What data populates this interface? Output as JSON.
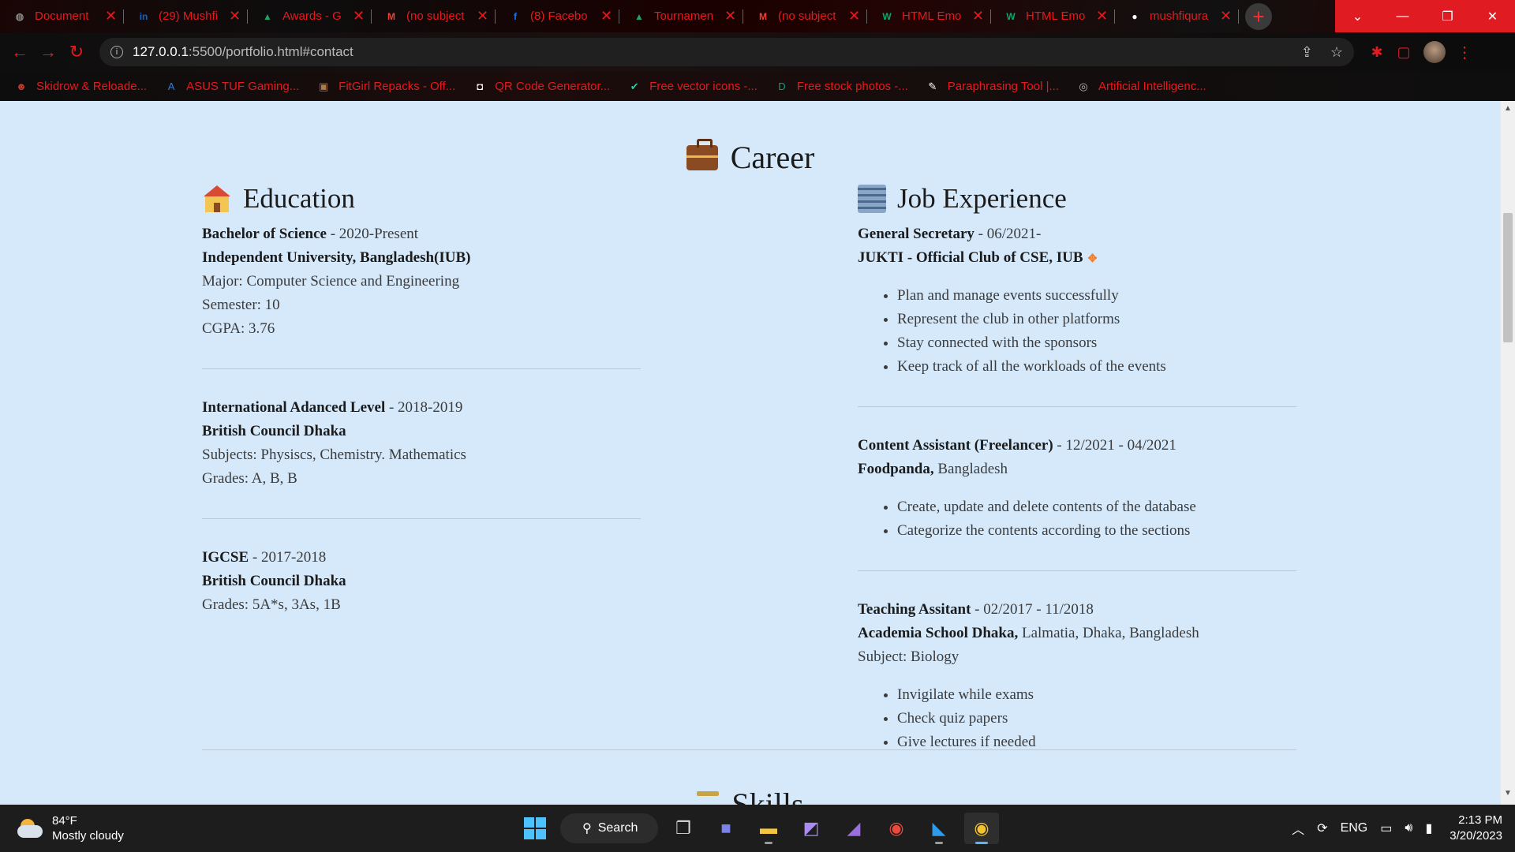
{
  "browser": {
    "tabs": [
      {
        "title": "Document",
        "icon": "globe-icon",
        "icon_char": "◍",
        "icon_color": "#888888"
      },
      {
        "title": "(29) Mushfi",
        "icon": "linkedin-icon",
        "icon_char": "in",
        "icon_color": "#0a66c2"
      },
      {
        "title": "Awards - G",
        "icon": "google-drive-icon",
        "icon_char": "▲",
        "icon_color": "#1fa463"
      },
      {
        "title": "(no subject",
        "icon": "gmail-icon",
        "icon_char": "M",
        "icon_color": "#ea4335"
      },
      {
        "title": "(8) Facebo",
        "icon": "facebook-icon",
        "icon_char": "f",
        "icon_color": "#1877f2"
      },
      {
        "title": "Tournamen",
        "icon": "google-drive-icon",
        "icon_char": "▲",
        "icon_color": "#1fa463"
      },
      {
        "title": "(no subject",
        "icon": "gmail-icon",
        "icon_char": "M",
        "icon_color": "#ea4335"
      },
      {
        "title": "HTML Emo",
        "icon": "w3schools-icon",
        "icon_char": "W",
        "icon_color": "#04aa6d"
      },
      {
        "title": "HTML Emo",
        "icon": "w3schools-icon",
        "icon_char": "W",
        "icon_color": "#04aa6d"
      },
      {
        "title": "mushfiqura",
        "icon": "github-icon",
        "icon_char": "●",
        "icon_color": "#ffffff"
      }
    ],
    "close_glyph": "✕",
    "new_tab_glyph": "+",
    "window_controls": {
      "dropdown": "⌄",
      "minimize": "—",
      "restore": "❐",
      "close": "✕"
    },
    "address": {
      "host": "127.0.0.1",
      "rest": ":5500/portfolio.html#contact"
    },
    "bookmarks": [
      {
        "label": "Skidrow & Reloade...",
        "icon": "skidrow-icon",
        "icon_char": "☻",
        "icon_color": "#c0392b"
      },
      {
        "label": "ASUS TUF Gaming...",
        "icon": "asus-tuf-icon",
        "icon_char": "A",
        "icon_color": "#2f7de1"
      },
      {
        "label": "FitGirl Repacks - Off...",
        "icon": "fitgirl-icon",
        "icon_char": "▣",
        "icon_color": "#b07a4a"
      },
      {
        "label": "QR Code Generator...",
        "icon": "qr-code-icon",
        "icon_char": "◘",
        "icon_color": "#ffffff"
      },
      {
        "label": "Free vector icons -...",
        "icon": "vector-icons-icon",
        "icon_char": "✔",
        "icon_color": "#1dd1a1"
      },
      {
        "label": "Free stock photos -...",
        "icon": "stock-photos-icon",
        "icon_char": "D",
        "icon_color": "#05a081"
      },
      {
        "label": "Paraphrasing Tool |...",
        "icon": "pen-icon",
        "icon_char": "✎",
        "icon_color": "#ffffff"
      },
      {
        "label": "Artificial Intelligenc...",
        "icon": "openai-icon",
        "icon_char": "◎",
        "icon_color": "#bbbbbb"
      }
    ],
    "accent_color": "#e8191d"
  },
  "page": {
    "career_title": "Career",
    "education": {
      "heading": "Education",
      "entries": [
        {
          "degree": "Bachelor of Science",
          "period": " - 2020-Present",
          "institution": "Independent University, Bangladesh(IUB)",
          "details": [
            "Major: Computer Science and Engineering",
            "Semester: 10",
            "CGPA: 3.76"
          ]
        },
        {
          "degree": "International Adanced Level",
          "period": " - 2018-2019",
          "institution": "British Council Dhaka",
          "details": [
            "Subjects: Physiscs, Chemistry. Mathematics",
            "Grades: A, B, B"
          ]
        },
        {
          "degree": "IGCSE",
          "period": " - 2017-2018",
          "institution": "British Council Dhaka",
          "details": [
            "Grades: 5A*s, 3As, 1B"
          ]
        }
      ]
    },
    "jobs": {
      "heading": "Job Experience",
      "entries": [
        {
          "role": "General Secretary",
          "period": " - 06/2021-",
          "org": "JUKTI - Official Club of CSE, IUB",
          "org_suffix": "",
          "subject": "",
          "bullets": [
            "Plan and manage events successfully",
            "Represent the club in other platforms",
            "Stay connected with the sponsors",
            "Keep track of all the workloads of the events"
          ]
        },
        {
          "role": "Content Assistant (Freelancer)",
          "period": " - 12/2021 - 04/2021",
          "org": "Foodpanda,",
          "org_suffix": " Bangladesh",
          "subject": "",
          "bullets": [
            "Create, update and delete contents of the database",
            "Categorize the contents according to the sections"
          ]
        },
        {
          "role": "Teaching Assitant",
          "period": " - 02/2017 - 11/2018",
          "org": "Academia School Dhaka,",
          "org_suffix": " Lalmatia, Dhaka, Bangladesh",
          "subject": "Subject: Biology",
          "bullets": [
            "Invigilate while exams",
            "Check quiz papers",
            "Give lectures if needed"
          ]
        }
      ]
    },
    "skills_title": "Skills",
    "background_color": "#d6e9fb"
  },
  "taskbar": {
    "weather": {
      "temp": "84°F",
      "condition": "Mostly cloudy"
    },
    "search_label": "Search",
    "tray": {
      "language": "ENG",
      "time": "2:13 PM",
      "date": "3/20/2023"
    }
  }
}
